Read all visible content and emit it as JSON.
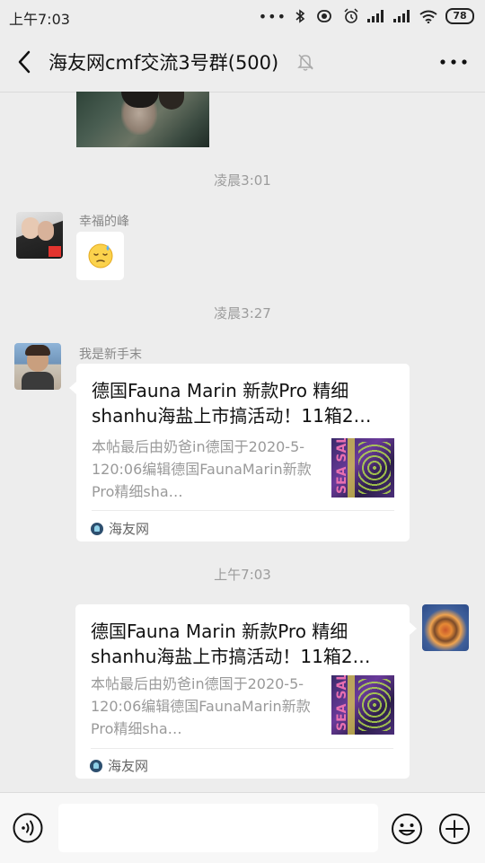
{
  "status_bar": {
    "time": "上午7:03",
    "battery": "78"
  },
  "header": {
    "title": "海友网cmf交流3号群(500)"
  },
  "chat": {
    "timestamps": [
      "凌晨3:01",
      "凌晨3:27",
      "上午7:03"
    ],
    "messages": [
      {
        "sender": "幸福的峰",
        "type": "emoji"
      },
      {
        "sender": "我是新手末",
        "type": "link_card",
        "title": "德国Fauna Marin 新款Pro 精细shanhu海盐上市搞活动！11箱2…",
        "description": "本帖最后由奶爸in德国于2020-5-120:06编辑德国FaunaMarin新款Pro精细sha…",
        "source": "海友网",
        "thumb_text": "SEA SALT"
      },
      {
        "sender": "",
        "type": "link_card",
        "title": "德国Fauna Marin 新款Pro 精细shanhu海盐上市搞活动！11箱2…",
        "description": "本帖最后由奶爸in德国于2020-5-120:06编辑德国FaunaMarin新款Pro精细sha…",
        "source": "海友网",
        "thumb_text": "SEA SALT"
      }
    ]
  },
  "input_bar": {
    "placeholder": ""
  },
  "icons": {
    "back": "chevron-left-icon",
    "mute": "bell-off-icon",
    "more": "more-horizontal-icon",
    "voice": "voice-icon",
    "emoji": "emoji-icon",
    "plus": "plus-icon"
  }
}
